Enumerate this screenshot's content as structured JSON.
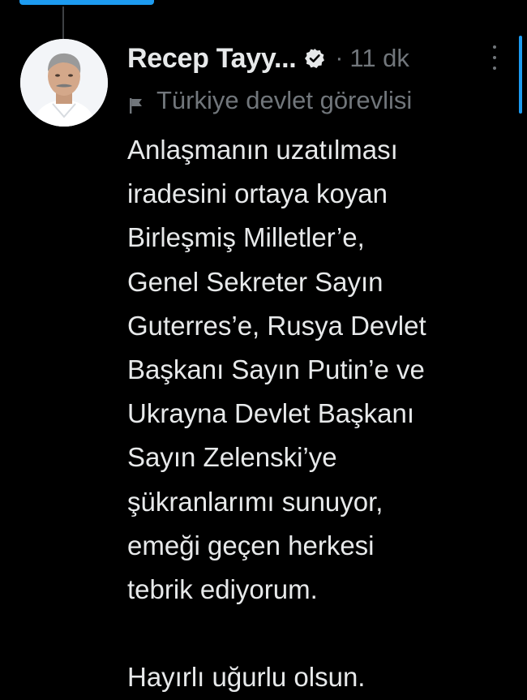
{
  "tweet": {
    "author_name": "Recep Tayy...",
    "separator": "·",
    "time_ago": "11 dk",
    "affiliation_label": "Türkiye devlet görevlisi",
    "body": "Anlaşmanın uzatılması\niradesini ortaya koyan\nBirleşmiş Milletler’e,\nGenel Sekreter Sayın\nGuterres’e, Rusya Devlet\nBaşkanı Sayın Putin’e ve\nUkrayna Devlet Başkanı\nSayın Zelenski’ye\nşükranlarımı sunuyor,\nemeği geçen herkesi\ntebrik ediyorum.\n\nHayırlı uğurlu olsun."
  },
  "icons": {
    "verified": "verified-badge-icon",
    "affiliation": "flag-icon",
    "more": "more-options-icon"
  },
  "colors": {
    "background": "#000000",
    "text_primary": "#e7e9ea",
    "text_secondary": "#71767b",
    "accent": "#1d9bf0",
    "thread_line": "#3e4144"
  }
}
